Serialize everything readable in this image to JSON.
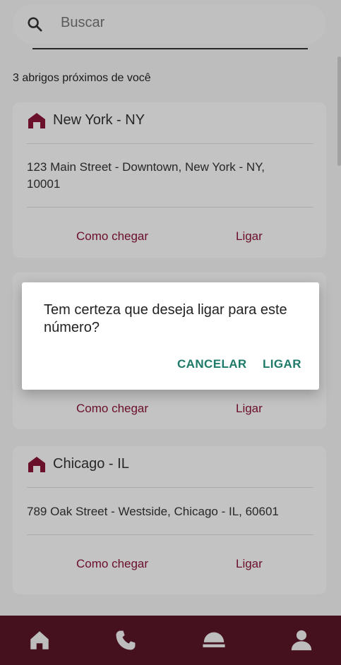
{
  "search": {
    "placeholder": "Buscar"
  },
  "results_count": "3 abrigos próximos de você",
  "shelters": [
    {
      "city": "New York - NY",
      "address": "123 Main Street - Downtown, New York - NY, 10001",
      "directions_label": "Como chegar",
      "call_label": "Ligar"
    },
    {
      "directions_label": "Como chegar",
      "call_label": "Ligar"
    },
    {
      "city": "Chicago - IL",
      "address": "789 Oak Street - Westside, Chicago - IL, 60601",
      "directions_label": "Como chegar",
      "call_label": "Ligar"
    }
  ],
  "dialog": {
    "message": "Tem certeza que deseja ligar para este número?",
    "cancel_label": "CANCELAR",
    "confirm_label": "LIGAR"
  },
  "bottom_nav": {
    "items": [
      {
        "icon": "home-icon"
      },
      {
        "icon": "phone-icon"
      },
      {
        "icon": "shelter-icon"
      },
      {
        "icon": "profile-icon"
      }
    ]
  },
  "colors": {
    "accent": "#8a1538",
    "dialog_button": "#1e7a68",
    "nav_background": "#5a1728"
  }
}
